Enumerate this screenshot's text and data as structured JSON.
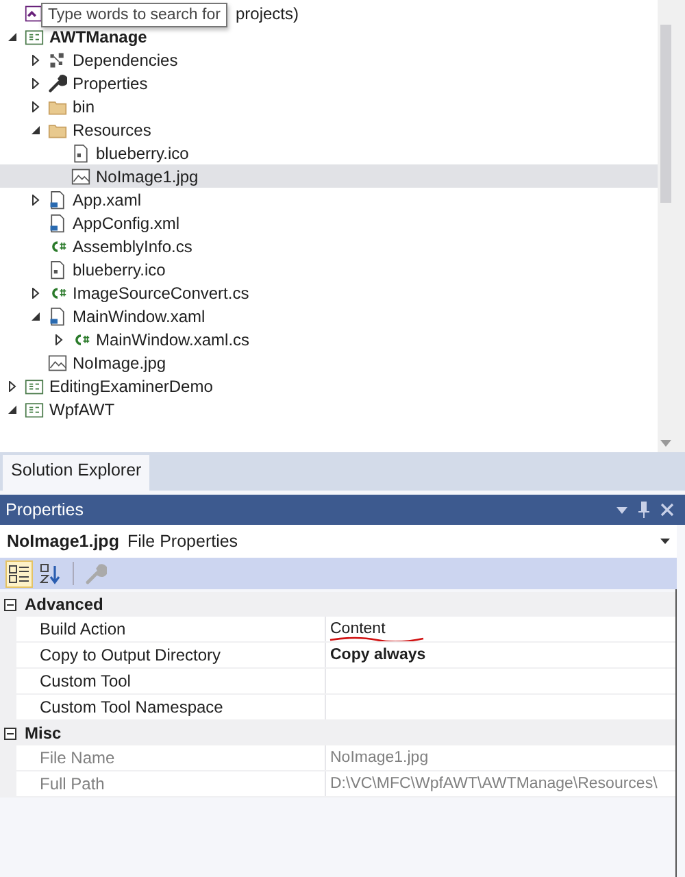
{
  "solution_explorer": {
    "tooltip": "Type words to search for",
    "tree": [
      {
        "label": "projects)",
        "kind": "solution",
        "selected": false,
        "bold": false
      },
      {
        "label": "AWTManage",
        "kind": "project",
        "expanded": true,
        "selected": false,
        "bold": true,
        "children": [
          {
            "label": "Dependencies",
            "kind": "dependencies",
            "expanded": false,
            "selected": false,
            "bold": false
          },
          {
            "label": "Properties",
            "kind": "wrench",
            "expanded": false,
            "selected": false,
            "bold": false
          },
          {
            "label": "bin",
            "kind": "folder",
            "expanded": false,
            "selected": false,
            "bold": false
          },
          {
            "label": "Resources",
            "kind": "folder",
            "expanded": true,
            "selected": false,
            "bold": false,
            "children": [
              {
                "label": "blueberry.ico",
                "kind": "icofile",
                "selected": false,
                "bold": false
              },
              {
                "label": "NoImage1.jpg",
                "kind": "image",
                "selected": true,
                "bold": false
              }
            ]
          },
          {
            "label": "App.xaml",
            "kind": "xaml",
            "expanded": false,
            "selected": false,
            "bold": false
          },
          {
            "label": "AppConfig.xml",
            "kind": "xaml",
            "selected": false,
            "bold": false
          },
          {
            "label": "AssemblyInfo.cs",
            "kind": "code",
            "selected": false,
            "bold": false
          },
          {
            "label": "blueberry.ico",
            "kind": "icofile",
            "selected": false,
            "bold": false
          },
          {
            "label": "ImageSourceConvert.cs",
            "kind": "code",
            "expanded": false,
            "selected": false,
            "bold": false
          },
          {
            "label": "MainWindow.xaml",
            "kind": "xaml",
            "expanded": true,
            "selected": false,
            "bold": false,
            "children": [
              {
                "label": "MainWindow.xaml.cs",
                "kind": "code",
                "expanded": false,
                "selected": false,
                "bold": false
              }
            ]
          },
          {
            "label": "NoImage.jpg",
            "kind": "image",
            "selected": false,
            "bold": false
          }
        ]
      },
      {
        "label": "EditingExaminerDemo",
        "kind": "project",
        "expanded": false,
        "selected": false,
        "bold": false
      },
      {
        "label": "WpfAWT",
        "kind": "project",
        "expanded": true,
        "selected": false,
        "bold": false
      }
    ],
    "tabs": [
      {
        "label": "Solution Explorer",
        "selected": true
      }
    ]
  },
  "properties": {
    "title": "Properties",
    "object_name": "NoImage1.jpg",
    "object_type": "File Properties",
    "categories": [
      {
        "name": "Advanced",
        "expanded": true,
        "rows": [
          {
            "name": "Build Action",
            "value": "Content",
            "modified": false,
            "readonly": false,
            "marked": true
          },
          {
            "name": "Copy to Output Directory",
            "value": "Copy always",
            "modified": true,
            "readonly": false,
            "marked": false
          },
          {
            "name": "Custom Tool",
            "readonly": false
          },
          {
            "name": "Custom Tool Namespace",
            "readonly": false
          }
        ]
      },
      {
        "name": "Misc",
        "expanded": true,
        "rows": [
          {
            "name": "File Name",
            "value": "NoImage1.jpg",
            "modified": false,
            "readonly": true,
            "marked": false
          },
          {
            "name": "Full Path",
            "value": "D:\\VC\\MFC\\WpfAWT\\AWTManage\\Resources\\",
            "modified": false,
            "readonly": true,
            "marked": false
          }
        ]
      }
    ]
  }
}
